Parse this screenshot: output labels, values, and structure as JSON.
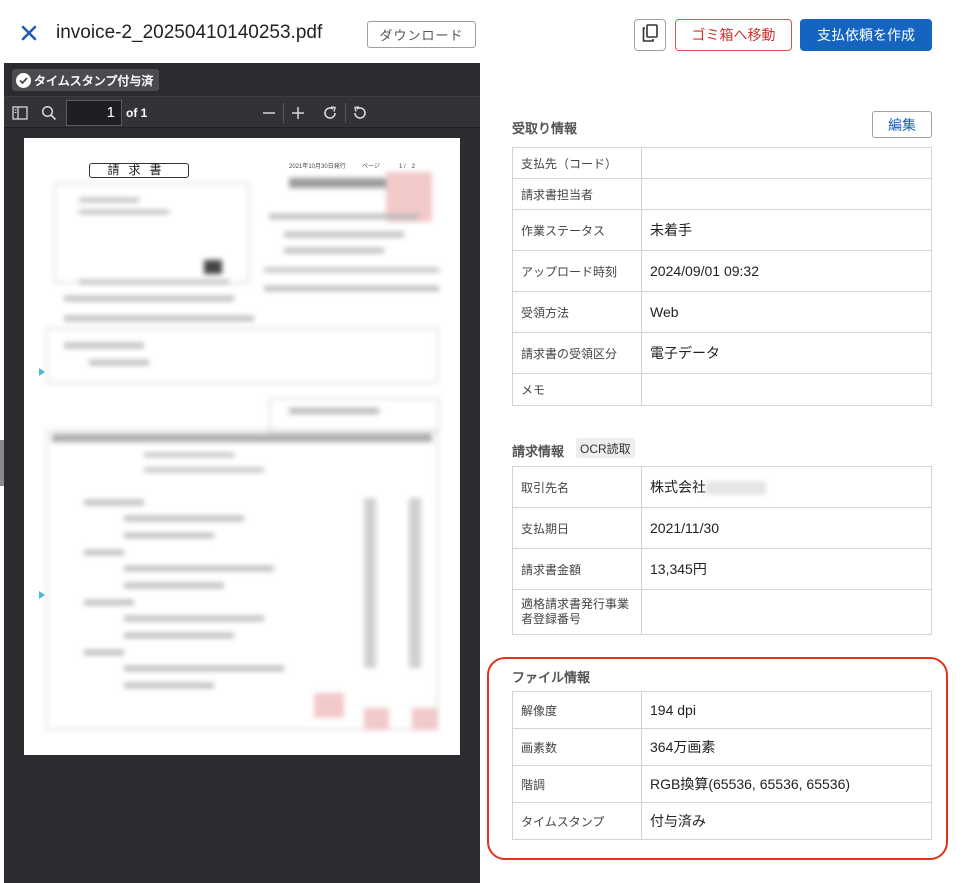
{
  "header": {
    "file_name": "invoice-2_20250410140253.pdf",
    "download_label": "ダウンロード",
    "trash_label": "ゴミ箱へ移動",
    "create_label": "支払依頼を作成"
  },
  "viewer": {
    "timestamp_badge": "タイムスタンプ付与済",
    "page_current": "1",
    "page_total": "of 1",
    "doc_title": "請求書",
    "doc_date": "2021年10月30日発行",
    "doc_page_label": "ページ",
    "doc_page_num": "1 /　2"
  },
  "receipt": {
    "title": "受取り情報",
    "edit_label": "編集",
    "rows": [
      {
        "label": "支払先（コード）",
        "value": ""
      },
      {
        "label": "請求書担当者",
        "value": ""
      },
      {
        "label": "作業ステータス",
        "value": "未着手"
      },
      {
        "label": "アップロード時刻",
        "value": "2024/09/01 09:32"
      },
      {
        "label": "受領方法",
        "value": "Web"
      },
      {
        "label": "請求書の受領区分",
        "value": "電子データ"
      },
      {
        "label": "メモ",
        "value": ""
      }
    ]
  },
  "invoice": {
    "title": "請求情報",
    "ocr_tag": "OCR読取",
    "rows": [
      {
        "label": "取引先名",
        "value": "株式会社"
      },
      {
        "label": "支払期日",
        "value": "2021/11/30"
      },
      {
        "label": "請求書金額",
        "value": "13,345円"
      },
      {
        "label": "適格請求書発行事業者登録番号",
        "value": ""
      }
    ]
  },
  "file": {
    "title": "ファイル情報",
    "rows": [
      {
        "label": "解像度",
        "value": "194 dpi"
      },
      {
        "label": "画素数",
        "value": "364万画素"
      },
      {
        "label": "階調",
        "value": "RGB換算(65536, 65536, 65536)"
      },
      {
        "label": "タイムスタンプ",
        "value": "付与済み"
      }
    ]
  },
  "colors": {
    "primary": "#1565c0",
    "danger": "#d0312d",
    "highlight": "#e3321b",
    "viewer_bg": "#2b2c2f"
  }
}
